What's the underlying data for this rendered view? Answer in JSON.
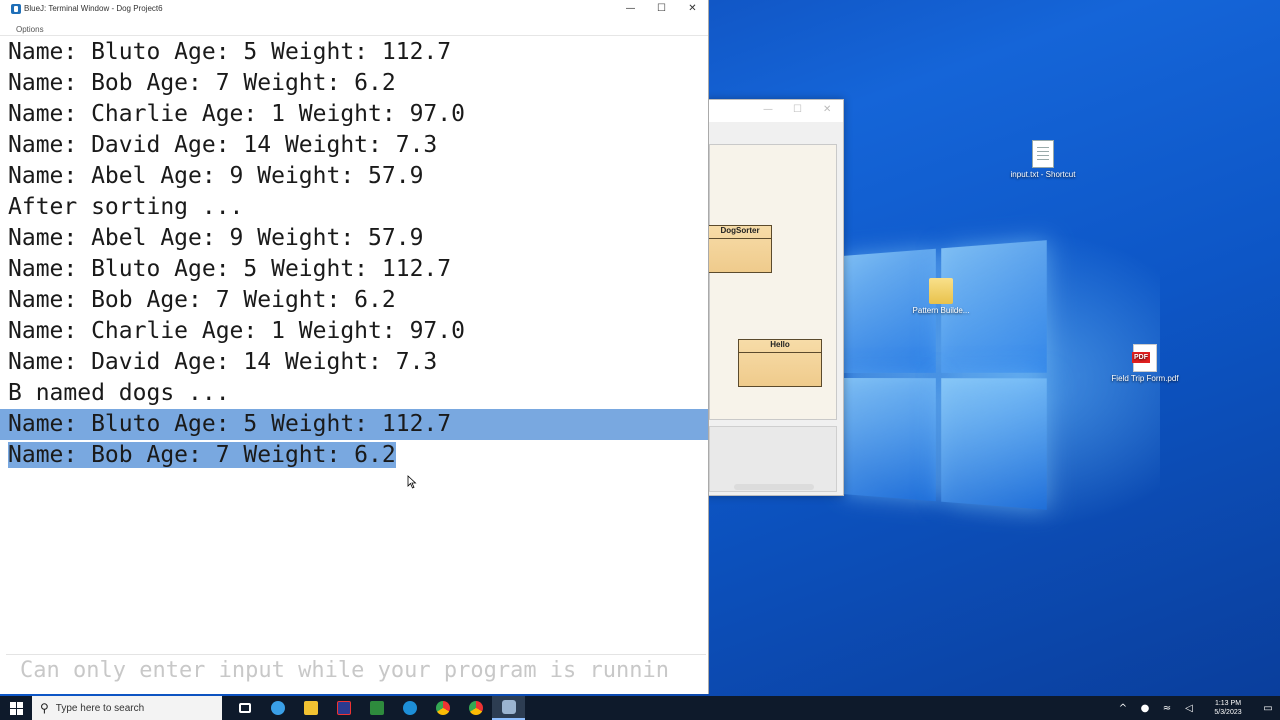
{
  "terminal": {
    "title": "BlueJ: Terminal Window - Dog Project6",
    "menu": [
      "Options"
    ],
    "controls": {
      "minimize": "—",
      "maximize": "☐",
      "close": "✕"
    },
    "lines": [
      "Name: Bluto Age: 5 Weight: 112.7",
      "Name: Bob Age: 7 Weight: 6.2",
      "Name: Charlie Age: 1 Weight: 97.0",
      "Name: David Age: 14 Weight: 7.3",
      "Name: Abel Age: 9 Weight: 57.9",
      "After sorting ...",
      "Name: Abel Age: 9 Weight: 57.9",
      "Name: Bluto Age: 5 Weight: 112.7",
      "Name: Bob Age: 7 Weight: 6.2",
      "Name: Charlie Age: 1 Weight: 97.0",
      "Name: David Age: 14 Weight: 7.3",
      "B named dogs ..."
    ],
    "selected_lines": [
      "Name: Bluto Age: 5 Weight: 112.7",
      "Name: Bob Age: 7 Weight: 6.2"
    ],
    "input_placeholder": "Can only enter input while your program is runnin"
  },
  "bluej": {
    "classes": [
      "DogSorter",
      "Hello"
    ]
  },
  "desktop": {
    "icons": [
      {
        "label": "input.txt - Shortcut",
        "icon": "text-file-shortcut-icon"
      },
      {
        "label": "Pattern Builde...",
        "icon": "folder-icon"
      },
      {
        "label": "Field Trip Form.pdf",
        "icon": "pdf-icon"
      }
    ]
  },
  "taskbar": {
    "search_placeholder": "Type here to search",
    "time": "1:13 PM",
    "date": "5/3/2023"
  }
}
